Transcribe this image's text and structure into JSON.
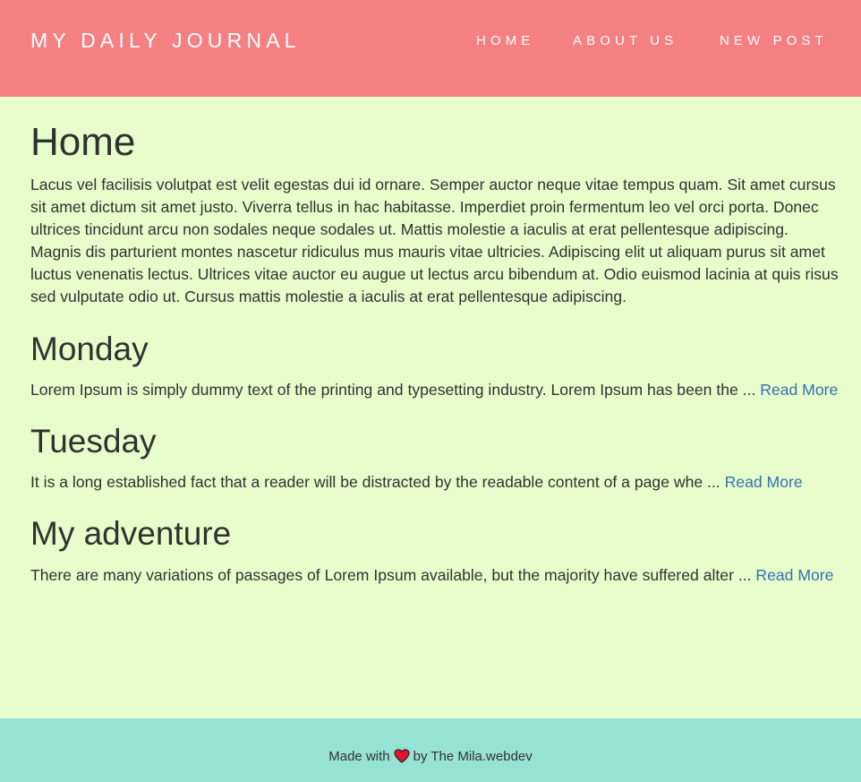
{
  "navbar": {
    "brand": "MY DAILY JOURNAL",
    "links": [
      "HOME",
      "ABOUT US",
      "NEW POST"
    ]
  },
  "home": {
    "title": "Home",
    "text": "Lacus vel facilisis volutpat est velit egestas dui id ornare. Semper auctor neque vitae tempus quam. Sit amet cursus sit amet dictum sit amet justo. Viverra tellus in hac habitasse. Imperdiet proin fermentum leo vel orci porta. Donec ultrices tincidunt arcu non sodales neque sodales ut. Mattis molestie a iaculis at erat pellentesque adipiscing. Magnis dis parturient montes nascetur ridiculus mus mauris vitae ultricies. Adipiscing elit ut aliquam purus sit amet luctus venenatis lectus. Ultrices vitae auctor eu augue ut lectus arcu bibendum at. Odio euismod lacinia at quis risus sed vulputate odio ut. Cursus mattis molestie a iaculis at erat pellentesque adipiscing."
  },
  "posts": [
    {
      "title": "Monday",
      "excerpt": "Lorem Ipsum is simply dummy text of the printing and typesetting industry. Lorem Ipsum has been the ...",
      "read_more": "Read More"
    },
    {
      "title": "Tuesday",
      "excerpt": "It is a long established fact that a reader will be distracted by the readable content of a page whe ...",
      "read_more": "Read More"
    },
    {
      "title": "My adventure",
      "excerpt": "There are many variations of passages of Lorem Ipsum available, but the majority have suffered alter ...",
      "read_more": "Read More"
    }
  ],
  "footer": {
    "made_with": "Made with",
    "heart_icon": "heart-icon",
    "by": "by The Mila.webdev"
  },
  "colors": {
    "navbar": "#f58082",
    "background": "#e8fdcc",
    "footer": "#96e2d5",
    "link": "#3470b3",
    "heart": "#e8112d"
  }
}
